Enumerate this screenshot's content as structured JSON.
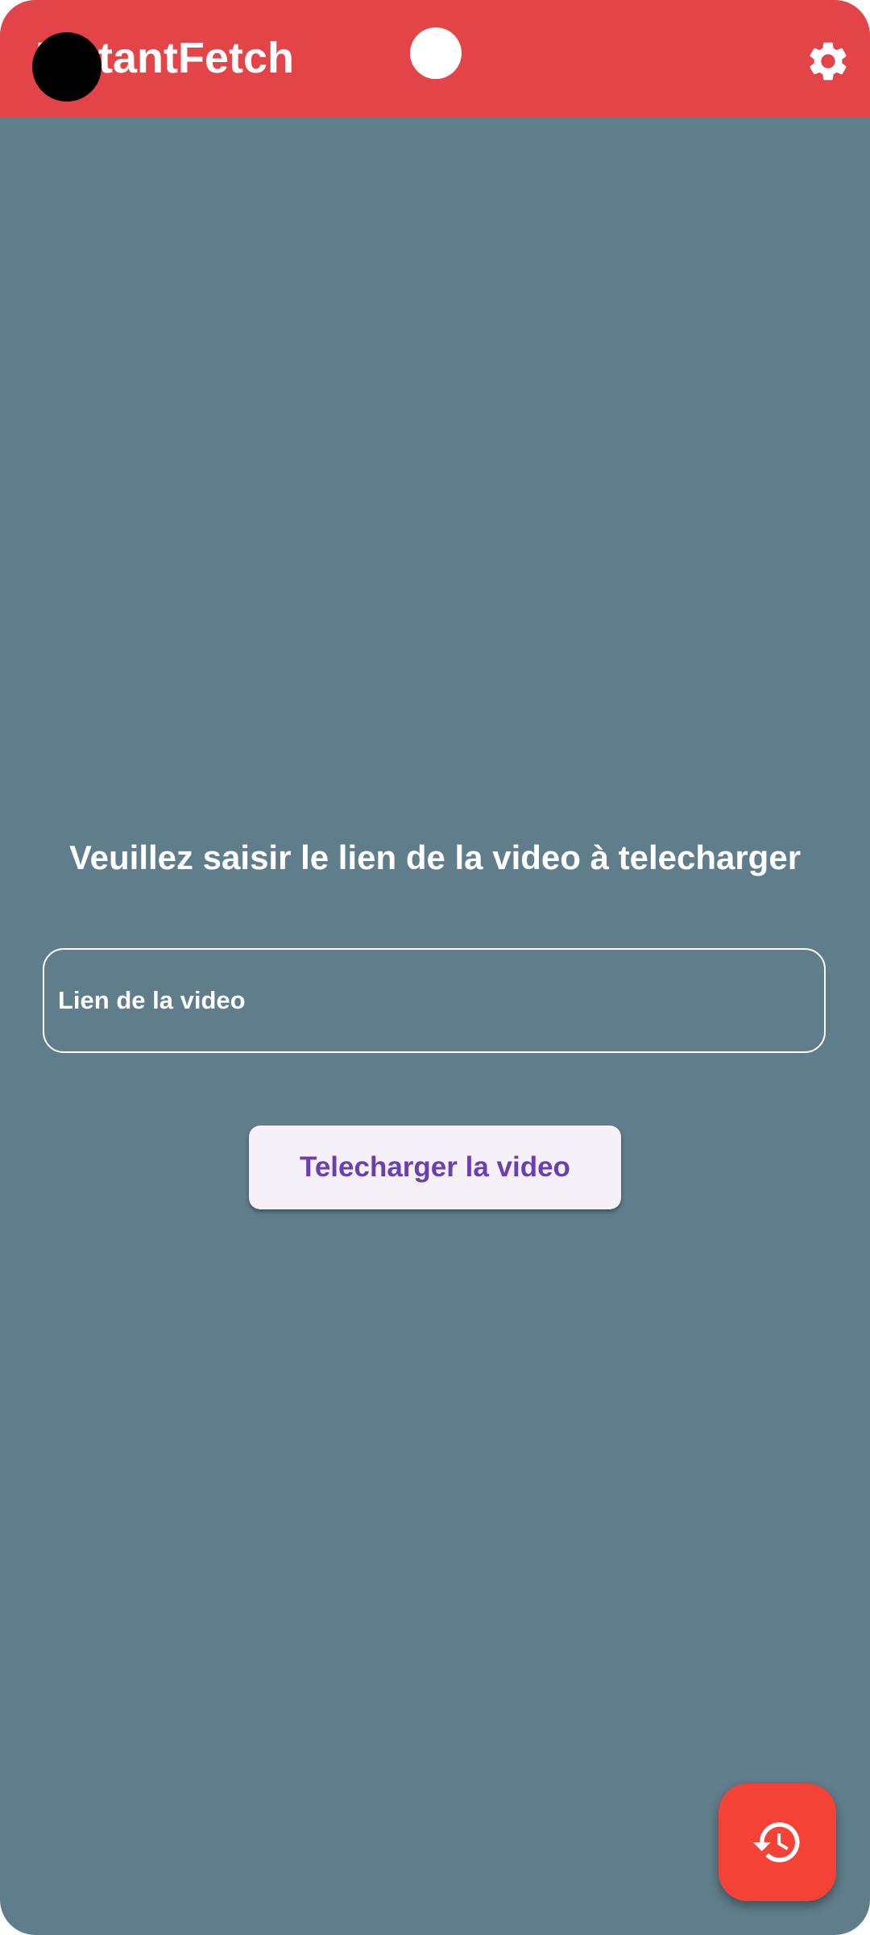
{
  "app_bar": {
    "title": "InstantFetch",
    "background_color": "#e34448",
    "settings_icon": "gear-icon"
  },
  "main": {
    "prompt": "Veuillez saisir le lien de la video à telecharger",
    "link_input": {
      "value": "",
      "placeholder": "Lien de la video"
    },
    "download_button_label": "Telecharger la video",
    "background_color": "#607d8b"
  },
  "fab": {
    "icon": "history-icon",
    "color": "#f44336"
  }
}
